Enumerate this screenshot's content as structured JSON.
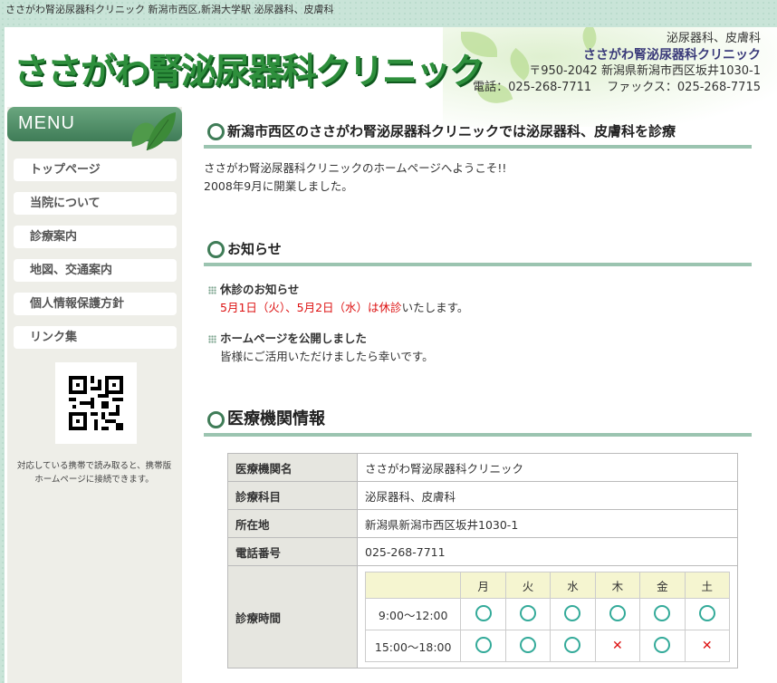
{
  "topbar": {
    "text": "ささがわ腎泌尿器科クリニック 新潟市西区,新潟大学駅 泌尿器科、皮膚科"
  },
  "header": {
    "logo": "ささがわ腎泌尿器科クリニック",
    "specialties": "泌尿器科、皮膚科",
    "clinic_name": "ささがわ腎泌尿器科クリニック",
    "address": "〒950-2042 新潟県新潟市西区坂井1030-1",
    "contact": "電話：025-268-7711　 ファックス：025-268-7715"
  },
  "sidebar": {
    "menu_title": "MENU",
    "items": [
      {
        "label": "トップページ"
      },
      {
        "label": "当院について"
      },
      {
        "label": "診療案内"
      },
      {
        "label": "地図、交通案内"
      },
      {
        "label": "個人情報保護方針"
      },
      {
        "label": "リンク集"
      }
    ],
    "qr_caption": "対応している携帯で読み取ると、携帯版ホームページに接続できます。"
  },
  "main": {
    "intro_title": "新潟市西区のささがわ腎泌尿器科クリニックでは泌尿器科、皮膚科を診療",
    "intro_line1": "ささがわ腎泌尿器科クリニックのホームページへようこそ!!",
    "intro_line2": "2008年9月に開業しました。",
    "news_title": "お知らせ",
    "news": [
      {
        "head": "休診のお知らせ",
        "body_red": "5月1日（火）、5月2日（水）は休診",
        "body_rest": "いたします。"
      },
      {
        "head": "ホームページを公開しました",
        "body": "皆様にご活用いただけましたら幸いです。"
      }
    ],
    "info_title": "医療機関情報",
    "info": [
      {
        "label": "医療機関名",
        "value": "ささがわ腎泌尿器科クリニック"
      },
      {
        "label": "診療科目",
        "value": "泌尿器科、皮膚科"
      },
      {
        "label": "所在地",
        "value": "新潟県新潟市西区坂井1030-1"
      },
      {
        "label": "電話番号",
        "value": "025-268-7711"
      }
    ],
    "hours_label": "診療時間",
    "schedule": {
      "days": [
        "月",
        "火",
        "水",
        "木",
        "金",
        "土"
      ],
      "rows": [
        {
          "time": "9:00〜12:00",
          "marks": [
            "○",
            "○",
            "○",
            "○",
            "○",
            "○"
          ]
        },
        {
          "time": "15:00〜18:00",
          "marks": [
            "○",
            "○",
            "○",
            "×",
            "○",
            "×"
          ]
        }
      ]
    }
  },
  "colors": {
    "accent": "#3f7c57",
    "logo": "#2e8f3c",
    "closed": "#dd1111"
  }
}
